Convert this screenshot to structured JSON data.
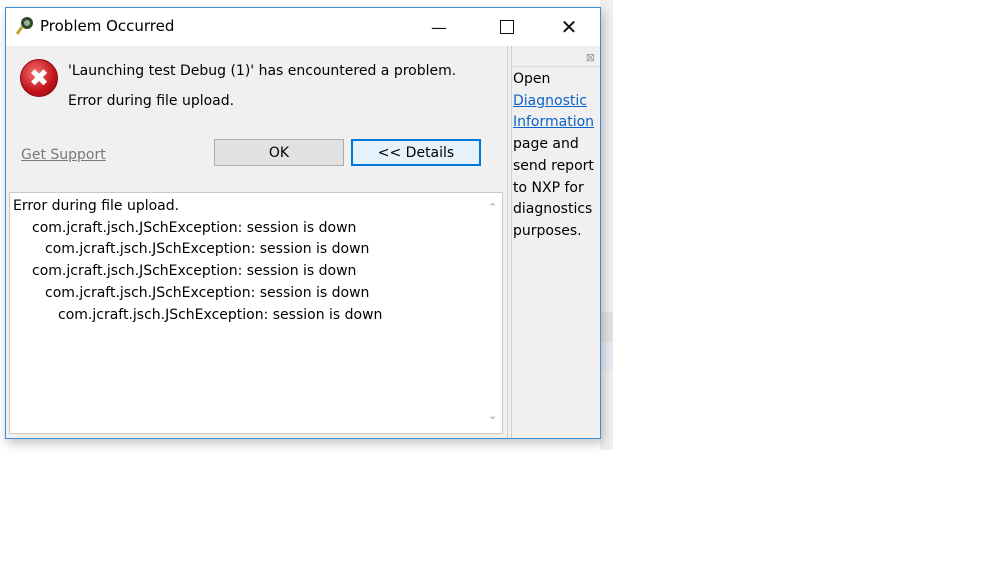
{
  "dialog": {
    "title": "Problem Occurred",
    "message": "'Launching test Debug (1)' has encountered a problem.",
    "reason": "Error during file upload.",
    "get_support": "Get Support",
    "ok_label": "OK",
    "details_label": "<< Details",
    "details_lines": [
      "Error during file upload.",
      "com.jcraft.jsch.JSchException: session is down",
      "com.jcraft.jsch.JSchException: session is down",
      "com.jcraft.jsch.JSchException: session is down",
      "com.jcraft.jsch.JSchException: session is down",
      "com.jcraft.jsch.JSchException: session is down"
    ]
  },
  "side_panel": {
    "open": "Open",
    "link": "Diagnostic Information",
    "rest": "page and send report to NXP for diagnostics purposes."
  },
  "colors": {
    "accent": "#0078d7",
    "link": "#0a64c8",
    "error": "#c1121a"
  }
}
